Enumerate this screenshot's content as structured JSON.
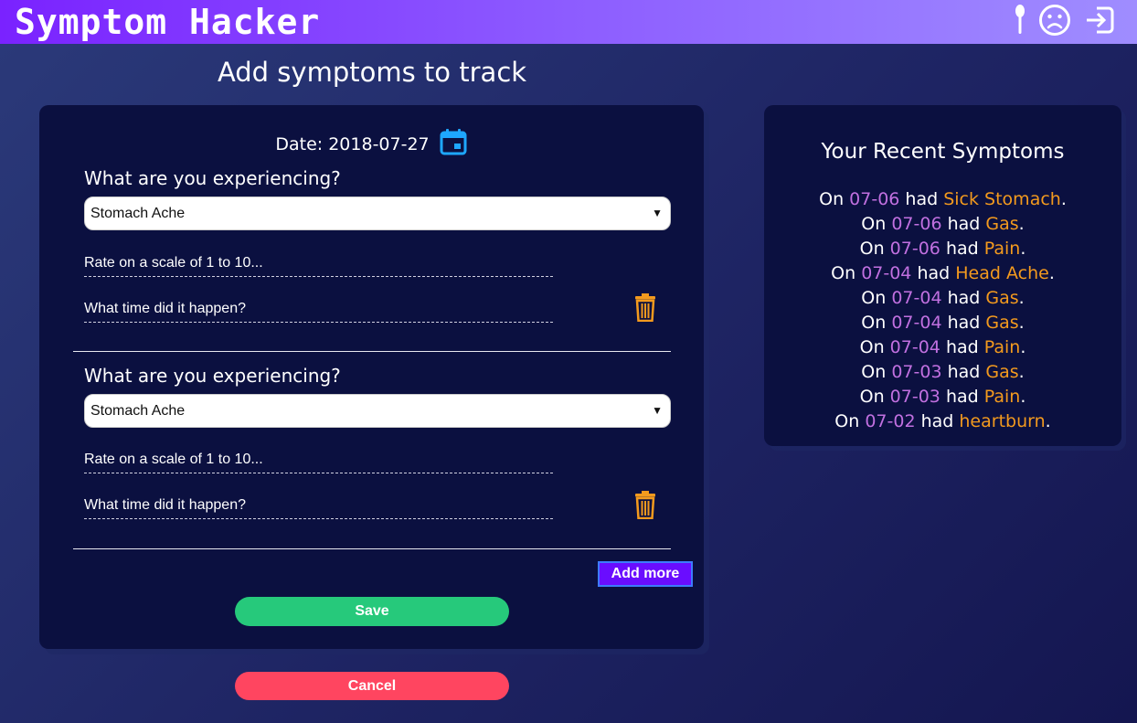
{
  "header": {
    "brand": "Symptom Hacker",
    "icons": [
      "spoon-icon",
      "sad-face-icon",
      "sign-out-icon"
    ]
  },
  "page_title": "Add symptoms to track",
  "form": {
    "date_label": "Date: 2018-07-27",
    "entries": [
      {
        "question": "What are you experiencing?",
        "selected": "Stomach Ache",
        "rate_placeholder": "Rate on a scale of 1 to 10...",
        "time_placeholder": "What time did it happen?"
      },
      {
        "question": "What are you experiencing?",
        "selected": "Stomach Ache",
        "rate_placeholder": "Rate on a scale of 1 to 10...",
        "time_placeholder": "What time did it happen?"
      }
    ],
    "add_more_label": "Add more",
    "save_label": "Save",
    "cancel_label": "Cancel"
  },
  "recent": {
    "title": "Your Recent Symptoms",
    "prefix": "On",
    "verb": "had",
    "items": [
      {
        "date": "07-06",
        "symptom": "Sick Stomach"
      },
      {
        "date": "07-06",
        "symptom": "Gas"
      },
      {
        "date": "07-06",
        "symptom": "Pain"
      },
      {
        "date": "07-04",
        "symptom": "Head Ache"
      },
      {
        "date": "07-04",
        "symptom": "Gas"
      },
      {
        "date": "07-04",
        "symptom": "Gas"
      },
      {
        "date": "07-04",
        "symptom": "Pain"
      },
      {
        "date": "07-03",
        "symptom": "Gas"
      },
      {
        "date": "07-03",
        "symptom": "Pain"
      },
      {
        "date": "07-02",
        "symptom": "heartburn"
      }
    ]
  },
  "colors": {
    "accent_purple": "#7a22ff",
    "date_text": "#c170e0",
    "symptom_text": "#f39a1e",
    "save": "#26c97b",
    "cancel": "#ff4560",
    "trash": "#f39a1e",
    "calendar": "#1ea7ff"
  }
}
